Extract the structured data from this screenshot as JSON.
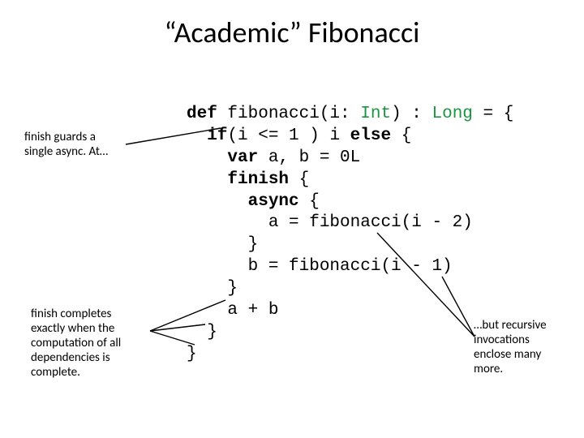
{
  "title": "“Academic” Fibonacci",
  "notes": {
    "top_line1": "finish guards a",
    "top_line2": "single async. At…",
    "bottom_line1": "finish completes",
    "bottom_line2": "exactly when the",
    "bottom_line3": "computation of all",
    "bottom_line4": "dependencies is",
    "bottom_line5": "complete.",
    "right_line1": "…but recursive",
    "right_line2": "invocations",
    "right_line3": "enclose many",
    "right_line4": "more."
  },
  "code": {
    "kw_def": "def",
    "fn_name": " fibonacci(i: ",
    "type_int": "Int",
    "sig_mid": ") : ",
    "type_long": "Long",
    "sig_end": " = {",
    "l2a": "  ",
    "kw_if": "if",
    "l2b": "(i <= 1 ) i ",
    "kw_else": "else",
    "l2c": " {",
    "l3a": "    ",
    "kw_var": "var",
    "l3b": " a, b = 0L",
    "l4a": "    ",
    "kw_finish": "finish",
    "l4b": " {",
    "l5a": "      ",
    "kw_async": "async",
    "l5b": " {",
    "l6": "        a = fibonacci(i - 2)",
    "l7": "      }",
    "l8": "      b = fibonacci(i - 1)",
    "l9": "    }",
    "l10": "    a + b",
    "l11": "  }",
    "l12": "}"
  }
}
